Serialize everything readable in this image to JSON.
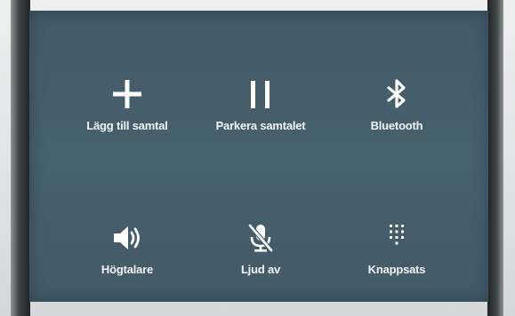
{
  "call_controls": {
    "add_call_label": "Lägg till samtal",
    "hold_call_label": "Parkera samtalet",
    "bluetooth_label": "Bluetooth",
    "speaker_label": "Högtalare",
    "mute_label": "Ljud av",
    "keypad_label": "Knappsats"
  },
  "icons": {
    "add_call": "plus-icon",
    "hold_call": "pause-icon",
    "bluetooth": "bluetooth-icon",
    "speaker": "speaker-icon",
    "mute": "microphone-off-icon",
    "keypad": "dialpad-icon"
  },
  "colors": {
    "panel_background": "#47606e",
    "text": "#f2f5f6",
    "icon": "#ffffff"
  }
}
